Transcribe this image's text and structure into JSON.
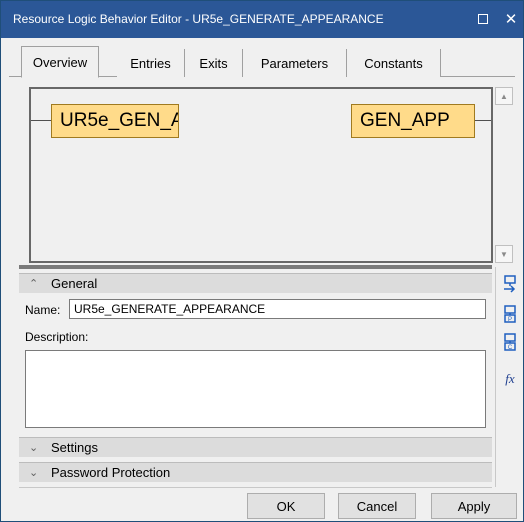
{
  "window": {
    "title": "Resource Logic Behavior Editor - UR5e_GENERATE_APPEARANCE",
    "maximize_icon": "maximize-icon",
    "close_glyph": "✕"
  },
  "tabs": [
    {
      "label": "Overview",
      "active": true
    },
    {
      "label": "Entries"
    },
    {
      "label": "Exits"
    },
    {
      "label": "Parameters"
    },
    {
      "label": "Constants"
    }
  ],
  "canvas": {
    "entry_node": "UR5e_GEN_A",
    "exit_node": "GEN_APP"
  },
  "general": {
    "header": "General",
    "name_label": "Name:",
    "name_value": "UR5e_GENERATE_APPEARANCE",
    "description_label": "Description:",
    "description_value": ""
  },
  "sections": {
    "settings": "Settings",
    "password": "Password Protection"
  },
  "toolbar_icons": [
    "entry-icon",
    "parameter-icon",
    "constant-icon",
    "function-icon"
  ],
  "buttons": {
    "ok": "OK",
    "cancel": "Cancel",
    "apply": "Apply"
  },
  "colors": {
    "titlebar": "#2b5797",
    "node_fill": "#ffdb8a"
  }
}
